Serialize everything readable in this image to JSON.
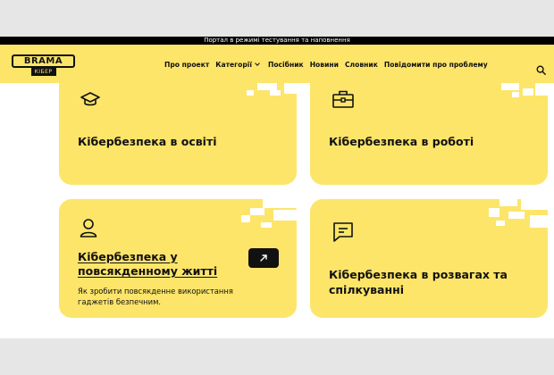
{
  "topbar": {
    "text": "Портал в режимі тестування та наповнення"
  },
  "header": {
    "logo_main": "BRAMA",
    "logo_sub": "КІБЕР",
    "nav": [
      "Про проект",
      "Категорії",
      "Посібник",
      "Новини",
      "Словник",
      "Повідомити про проблему"
    ]
  },
  "cards": [
    {
      "title": "Кібербезпека в освіті",
      "icon": "graduation-cap-icon"
    },
    {
      "title": "Кібербезпека в роботі",
      "icon": "briefcase-icon"
    },
    {
      "title_line1": "Кібербезпека у",
      "title_line2": "повсякденному житті",
      "description_line1": "Як зробити повсякденне використання",
      "description_line2": "гаджетів безпечним.",
      "icon": "person-icon"
    },
    {
      "title_line1": "Кібербезпека в розвагах та",
      "title_line2": "спілкуванні",
      "icon": "chat-icon"
    }
  ],
  "colors": {
    "accent": "#fde56a",
    "dark": "#111111"
  }
}
